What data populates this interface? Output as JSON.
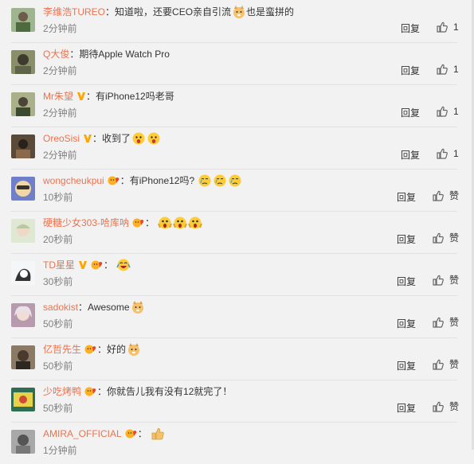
{
  "colors": {
    "username": "#eb7350",
    "time": "#808080",
    "text": "#333333",
    "badge": "#ffa500"
  },
  "comments": [
    {
      "user": "李维浩TUREO",
      "sep": "：",
      "text": "知道啦，还要CEO亲自引流",
      "text2": "也是蛮拼的",
      "time": "2分钟前",
      "reply": "回复",
      "like": "1",
      "avatar": "#7d9a6b"
    },
    {
      "user": "Q大俊",
      "sep": "：",
      "text": "期待Apple Watch Pro",
      "time": "2分钟前",
      "reply": "回复",
      "like": "1",
      "avatar": "#5a6b4a"
    },
    {
      "user": "Mr朱望",
      "sep": "：",
      "text": "有iPhone12吗老哥",
      "time": "2分钟前",
      "reply": "回复",
      "like": "1",
      "avatar": "#6d7a55"
    },
    {
      "user": "OreoSisi",
      "sep": "：",
      "text": "收到了",
      "time": "2分钟前",
      "reply": "回复",
      "like": "1",
      "avatar": "#4a4036"
    },
    {
      "user": "wongcheukpui",
      "sep": "：",
      "text": "有iPhone12吗?",
      "time": "10秒前",
      "reply": "回复",
      "like": "赞",
      "avatar": "#7a86c8"
    },
    {
      "user": "硬糖少女303-哈库呐",
      "sep": "：",
      "text": "",
      "time": "20秒前",
      "reply": "回复",
      "like": "赞",
      "avatar": "#c9d6b8"
    },
    {
      "user": "TD星星",
      "sep": "：",
      "text": "",
      "time": "30秒前",
      "reply": "回复",
      "like": "赞",
      "avatar": "#e8eef2"
    },
    {
      "user": "sadokist",
      "sep": "：",
      "text": "Awesome",
      "time": "50秒前",
      "reply": "回复",
      "like": "赞",
      "avatar": "#8a6a7a"
    },
    {
      "user": "亿哲先生",
      "sep": "：",
      "text": "好的",
      "time": "50秒前",
      "reply": "回复",
      "like": "赞",
      "avatar": "#7a6a58"
    },
    {
      "user": "少吃烤鸭",
      "sep": "：",
      "text": "你就告儿我有没有12就完了！",
      "time": "50秒前",
      "reply": "回复",
      "like": "赞",
      "avatar": "#3f7a5a"
    },
    {
      "user": "AMIRA_OFFICIAL",
      "sep": "：",
      "text": "",
      "time": "1分钟前",
      "reply": "回复",
      "like": "赞",
      "avatar": "#9a9a9a"
    }
  ]
}
